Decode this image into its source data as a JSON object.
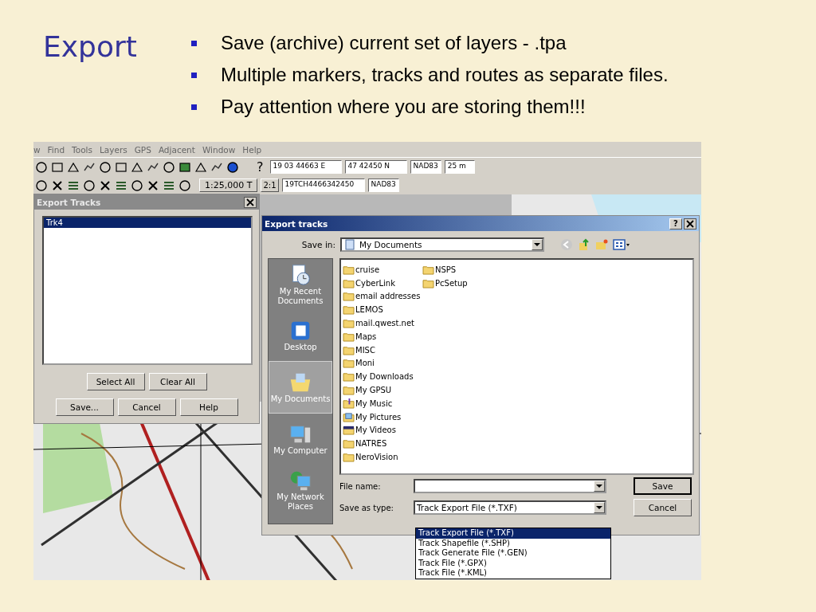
{
  "slide": {
    "title": "Export",
    "bullets": [
      "Save (archive) current set of layers - .tpa",
      "Multiple markers, tracks and routes as separate files.",
      "Pay attention where you are storing them!!!"
    ]
  },
  "app": {
    "menu": [
      "w",
      "Find",
      "Tools",
      "Layers",
      "GPS",
      "Adjacent",
      "Window",
      "Help"
    ],
    "help_mark": "?",
    "row1_fields": [
      "19 03 44663 E",
      "47 42450 N",
      "NAD83",
      "25 m"
    ],
    "scale_button": "1:25,000 T",
    "ratio_button": "2:1",
    "row2_fields": [
      "19TCH4466342450",
      "NAD83"
    ]
  },
  "export_tracks": {
    "title": "Export Tracks",
    "items": [
      {
        "label": "Trk4",
        "selected": true
      }
    ],
    "select_buttons": [
      "Select All",
      "Clear All"
    ],
    "buttons": [
      "Save...",
      "Cancel",
      "Help"
    ]
  },
  "file_dialog": {
    "title": "Export tracks",
    "help_button": "?",
    "save_in_label": "Save in:",
    "save_in_value": "My Documents",
    "places": [
      {
        "label": "My Recent Documents",
        "kind": "recent",
        "selected": false
      },
      {
        "label": "Desktop",
        "kind": "desktop",
        "selected": false
      },
      {
        "label": "My Documents",
        "kind": "documents",
        "selected": true
      },
      {
        "label": "My Computer",
        "kind": "computer",
        "selected": false
      },
      {
        "label": "My Network Places",
        "kind": "network",
        "selected": false
      }
    ],
    "folders": [
      {
        "name": "cruise",
        "kind": "folder"
      },
      {
        "name": "CyberLink",
        "kind": "folder"
      },
      {
        "name": "email addresses",
        "kind": "folder"
      },
      {
        "name": "LEMOS",
        "kind": "folder"
      },
      {
        "name": "mail.qwest.net",
        "kind": "folder"
      },
      {
        "name": "Maps",
        "kind": "folder"
      },
      {
        "name": "MISC",
        "kind": "folder"
      },
      {
        "name": "Moni",
        "kind": "folder"
      },
      {
        "name": "My Downloads",
        "kind": "folder"
      },
      {
        "name": "My GPSU",
        "kind": "folder"
      },
      {
        "name": "My Music",
        "kind": "music"
      },
      {
        "name": "My Pictures",
        "kind": "pictures"
      },
      {
        "name": "My Videos",
        "kind": "videos"
      },
      {
        "name": "NATRES",
        "kind": "folder"
      },
      {
        "name": "NeroVision",
        "kind": "folder"
      },
      {
        "name": "NSPS",
        "kind": "folder"
      },
      {
        "name": "PcSetup",
        "kind": "folder"
      }
    ],
    "file_name_label": "File name:",
    "save_as_type_label": "Save as type:",
    "save_as_type_value": "Track Export File (*.TXF)",
    "type_options": [
      {
        "label": "Track Export File (*.TXF)",
        "selected": true
      },
      {
        "label": "Track Shapefile (*.SHP)",
        "selected": false
      },
      {
        "label": "Track Generate File (*.GEN)",
        "selected": false
      },
      {
        "label": "Track File (*.GPX)",
        "selected": false
      },
      {
        "label": "Track File (*.KML)",
        "selected": false
      }
    ],
    "buttons": [
      "Save",
      "Cancel"
    ]
  }
}
